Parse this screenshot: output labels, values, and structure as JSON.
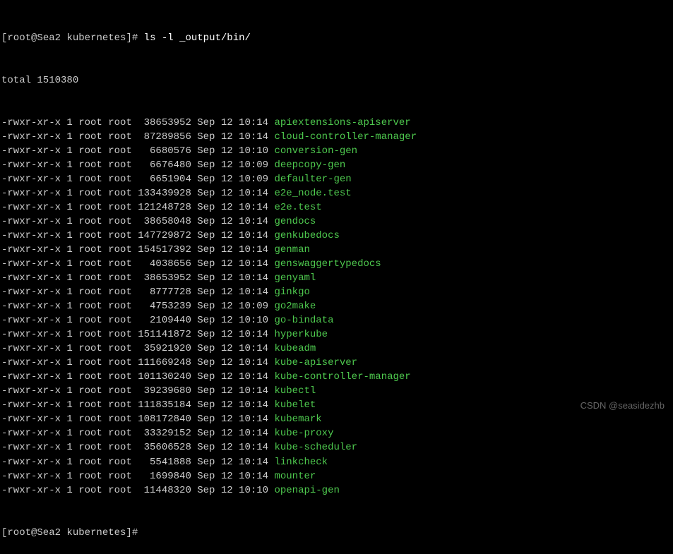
{
  "prompt": {
    "user": "root",
    "host": "Sea2",
    "dir": "kubernetes",
    "cmd": "ls -l _output/bin/"
  },
  "total_line": "total 1510380",
  "files": [
    {
      "perm": "-rwxr-xr-x",
      "links": "1",
      "owner": "root",
      "group": "root",
      "size": " 38653952",
      "month": "Sep",
      "day": "12",
      "time": "10:14",
      "name": "apiextensions-apiserver"
    },
    {
      "perm": "-rwxr-xr-x",
      "links": "1",
      "owner": "root",
      "group": "root",
      "size": " 87289856",
      "month": "Sep",
      "day": "12",
      "time": "10:14",
      "name": "cloud-controller-manager"
    },
    {
      "perm": "-rwxr-xr-x",
      "links": "1",
      "owner": "root",
      "group": "root",
      "size": "  6680576",
      "month": "Sep",
      "day": "12",
      "time": "10:10",
      "name": "conversion-gen"
    },
    {
      "perm": "-rwxr-xr-x",
      "links": "1",
      "owner": "root",
      "group": "root",
      "size": "  6676480",
      "month": "Sep",
      "day": "12",
      "time": "10:09",
      "name": "deepcopy-gen"
    },
    {
      "perm": "-rwxr-xr-x",
      "links": "1",
      "owner": "root",
      "group": "root",
      "size": "  6651904",
      "month": "Sep",
      "day": "12",
      "time": "10:09",
      "name": "defaulter-gen"
    },
    {
      "perm": "-rwxr-xr-x",
      "links": "1",
      "owner": "root",
      "group": "root",
      "size": "133439928",
      "month": "Sep",
      "day": "12",
      "time": "10:14",
      "name": "e2e_node.test"
    },
    {
      "perm": "-rwxr-xr-x",
      "links": "1",
      "owner": "root",
      "group": "root",
      "size": "121248728",
      "month": "Sep",
      "day": "12",
      "time": "10:14",
      "name": "e2e.test"
    },
    {
      "perm": "-rwxr-xr-x",
      "links": "1",
      "owner": "root",
      "group": "root",
      "size": " 38658048",
      "month": "Sep",
      "day": "12",
      "time": "10:14",
      "name": "gendocs"
    },
    {
      "perm": "-rwxr-xr-x",
      "links": "1",
      "owner": "root",
      "group": "root",
      "size": "147729872",
      "month": "Sep",
      "day": "12",
      "time": "10:14",
      "name": "genkubedocs"
    },
    {
      "perm": "-rwxr-xr-x",
      "links": "1",
      "owner": "root",
      "group": "root",
      "size": "154517392",
      "month": "Sep",
      "day": "12",
      "time": "10:14",
      "name": "genman"
    },
    {
      "perm": "-rwxr-xr-x",
      "links": "1",
      "owner": "root",
      "group": "root",
      "size": "  4038656",
      "month": "Sep",
      "day": "12",
      "time": "10:14",
      "name": "genswaggertypedocs"
    },
    {
      "perm": "-rwxr-xr-x",
      "links": "1",
      "owner": "root",
      "group": "root",
      "size": " 38653952",
      "month": "Sep",
      "day": "12",
      "time": "10:14",
      "name": "genyaml"
    },
    {
      "perm": "-rwxr-xr-x",
      "links": "1",
      "owner": "root",
      "group": "root",
      "size": "  8777728",
      "month": "Sep",
      "day": "12",
      "time": "10:14",
      "name": "ginkgo"
    },
    {
      "perm": "-rwxr-xr-x",
      "links": "1",
      "owner": "root",
      "group": "root",
      "size": "  4753239",
      "month": "Sep",
      "day": "12",
      "time": "10:09",
      "name": "go2make"
    },
    {
      "perm": "-rwxr-xr-x",
      "links": "1",
      "owner": "root",
      "group": "root",
      "size": "  2109440",
      "month": "Sep",
      "day": "12",
      "time": "10:10",
      "name": "go-bindata"
    },
    {
      "perm": "-rwxr-xr-x",
      "links": "1",
      "owner": "root",
      "group": "root",
      "size": "151141872",
      "month": "Sep",
      "day": "12",
      "time": "10:14",
      "name": "hyperkube"
    },
    {
      "perm": "-rwxr-xr-x",
      "links": "1",
      "owner": "root",
      "group": "root",
      "size": " 35921920",
      "month": "Sep",
      "day": "12",
      "time": "10:14",
      "name": "kubeadm"
    },
    {
      "perm": "-rwxr-xr-x",
      "links": "1",
      "owner": "root",
      "group": "root",
      "size": "111669248",
      "month": "Sep",
      "day": "12",
      "time": "10:14",
      "name": "kube-apiserver"
    },
    {
      "perm": "-rwxr-xr-x",
      "links": "1",
      "owner": "root",
      "group": "root",
      "size": "101130240",
      "month": "Sep",
      "day": "12",
      "time": "10:14",
      "name": "kube-controller-manager"
    },
    {
      "perm": "-rwxr-xr-x",
      "links": "1",
      "owner": "root",
      "group": "root",
      "size": " 39239680",
      "month": "Sep",
      "day": "12",
      "time": "10:14",
      "name": "kubectl"
    },
    {
      "perm": "-rwxr-xr-x",
      "links": "1",
      "owner": "root",
      "group": "root",
      "size": "111835184",
      "month": "Sep",
      "day": "12",
      "time": "10:14",
      "name": "kubelet"
    },
    {
      "perm": "-rwxr-xr-x",
      "links": "1",
      "owner": "root",
      "group": "root",
      "size": "108172840",
      "month": "Sep",
      "day": "12",
      "time": "10:14",
      "name": "kubemark"
    },
    {
      "perm": "-rwxr-xr-x",
      "links": "1",
      "owner": "root",
      "group": "root",
      "size": " 33329152",
      "month": "Sep",
      "day": "12",
      "time": "10:14",
      "name": "kube-proxy"
    },
    {
      "perm": "-rwxr-xr-x",
      "links": "1",
      "owner": "root",
      "group": "root",
      "size": " 35606528",
      "month": "Sep",
      "day": "12",
      "time": "10:14",
      "name": "kube-scheduler"
    },
    {
      "perm": "-rwxr-xr-x",
      "links": "1",
      "owner": "root",
      "group": "root",
      "size": "  5541888",
      "month": "Sep",
      "day": "12",
      "time": "10:14",
      "name": "linkcheck"
    },
    {
      "perm": "-rwxr-xr-x",
      "links": "1",
      "owner": "root",
      "group": "root",
      "size": "  1699840",
      "month": "Sep",
      "day": "12",
      "time": "10:14",
      "name": "mounter"
    },
    {
      "perm": "-rwxr-xr-x",
      "links": "1",
      "owner": "root",
      "group": "root",
      "size": " 11448320",
      "month": "Sep",
      "day": "12",
      "time": "10:10",
      "name": "openapi-gen"
    }
  ],
  "prompt2": {
    "full": "[root@Sea2 kubernetes]# "
  },
  "watermark": "CSDN @seasidezhb"
}
